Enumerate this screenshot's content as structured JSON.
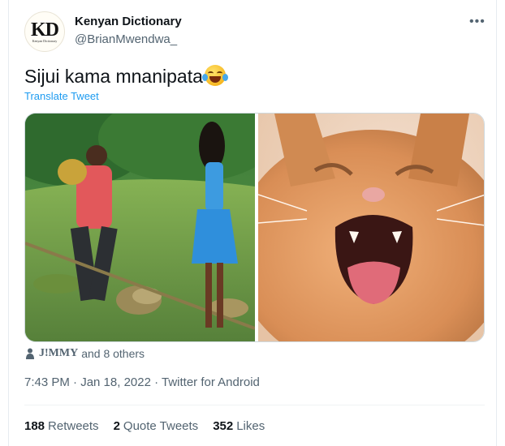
{
  "account": {
    "display_name": "Kenyan Dictionary",
    "handle": "@BrianMwendwa_",
    "avatar_text": "KD",
    "avatar_subtext": "Kenyan Dictionary"
  },
  "tweet": {
    "text": "Sijui kama mnanipata",
    "emoji": "face-with-tears-of-joy",
    "translate_label": "Translate Tweet",
    "images": [
      {
        "semantic": "man-swinging-stick-woman-in-blue-dress-field"
      },
      {
        "semantic": "orange-kitten-crying"
      }
    ]
  },
  "engagement_preview": {
    "first_name": "J!MMY",
    "others_text": "and 8 others"
  },
  "timestamp": {
    "time": "7:43 PM",
    "date": "Jan 18, 2022",
    "source": "Twitter for Android",
    "full": "7:43 PM · Jan 18, 2022 · Twitter for Android"
  },
  "stats": {
    "retweets_count": "188",
    "retweets_label": "Retweets",
    "quotes_count": "2",
    "quotes_label": "Quote Tweets",
    "likes_count": "352",
    "likes_label": "Likes"
  },
  "colors": {
    "link": "#1d9bf0",
    "secondary_text": "#536471",
    "primary_text": "#0f1419",
    "border": "#cfd9de"
  },
  "icons": [
    "more-icon",
    "person-icon",
    "face-with-tears-of-joy-icon"
  ]
}
